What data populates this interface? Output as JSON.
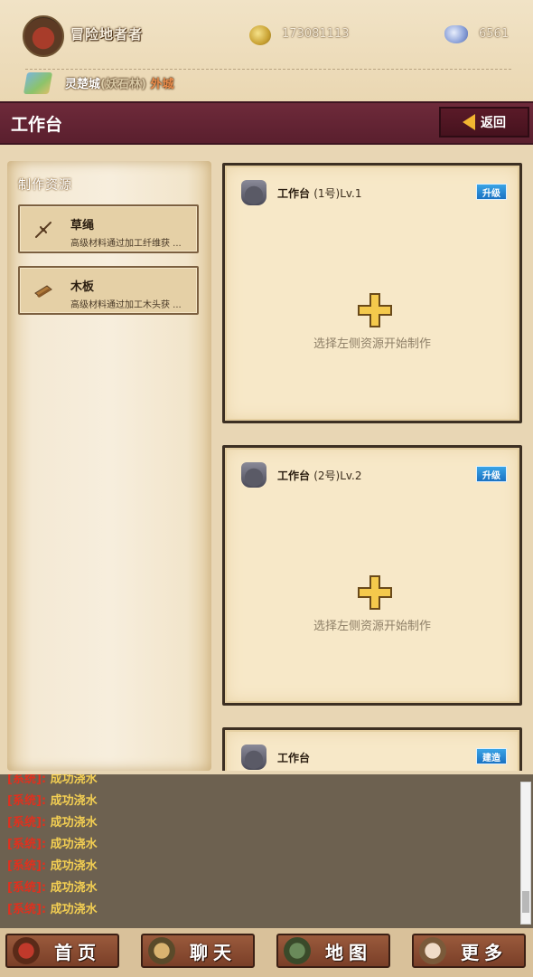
{
  "header": {
    "player_name": "冒险地者者",
    "gold": "173081113",
    "gems": "6561",
    "location_name": "灵楚城",
    "location_sub": "(妖石林)",
    "location_outer": "外城"
  },
  "title_bar": {
    "title": "工作台",
    "back_label": "返回"
  },
  "resources": {
    "title": "制作资源",
    "items": [
      {
        "name": "草绳",
        "desc": "高级材料通过加工纤维获 ..."
      },
      {
        "name": "木板",
        "desc": "高级材料通过加工木头获 ..."
      }
    ]
  },
  "benches": [
    {
      "name": "工作台",
      "number": "(1号)",
      "level": "Lv.1",
      "button": "升级",
      "hint": "选择左侧资源开始制作"
    },
    {
      "name": "工作台",
      "number": "(2号)",
      "level": "Lv.2",
      "button": "升级",
      "hint": "选择左侧资源开始制作"
    },
    {
      "name": "工作台",
      "number": "",
      "level": "",
      "button": "建造",
      "hint": ""
    }
  ],
  "log": [
    {
      "tag": "[系统]:",
      "text": "成功浇水"
    },
    {
      "tag": "[系统]:",
      "text": "成功浇水"
    },
    {
      "tag": "[系统]:",
      "text": "成功浇水"
    },
    {
      "tag": "[系统]:",
      "text": "成功浇水"
    },
    {
      "tag": "[系统]:",
      "text": "成功浇水"
    },
    {
      "tag": "[系统]:",
      "text": "成功浇水"
    },
    {
      "tag": "[系统]:",
      "text": "成功浇水"
    }
  ],
  "nav": [
    {
      "label": "首页",
      "icon": "home-avatar-icon"
    },
    {
      "label": "聊天",
      "icon": "chat-avatar-icon"
    },
    {
      "label": "地图",
      "icon": "map-avatar-icon"
    },
    {
      "label": "更多",
      "icon": "more-avatar-icon"
    }
  ],
  "colors": {
    "title_bar": "#6e2a3a",
    "upgrade_button": "#1b72c2",
    "log_tag": "#e0301e",
    "log_text": "#f4cf52"
  }
}
